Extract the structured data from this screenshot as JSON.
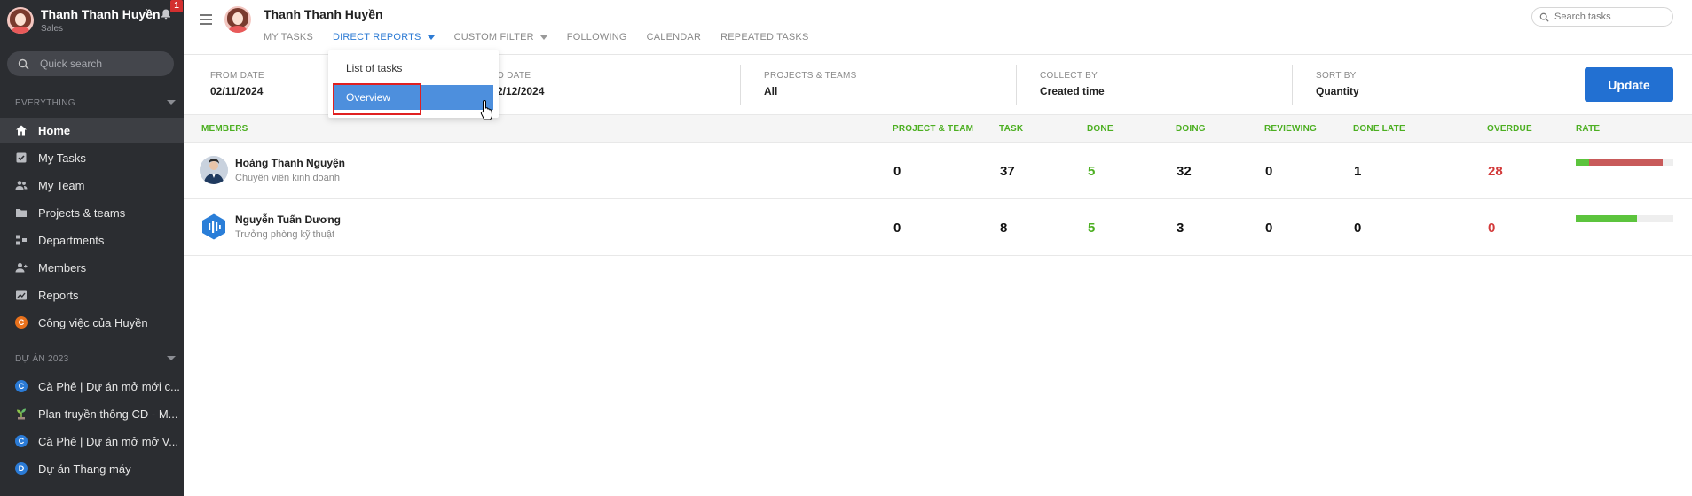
{
  "sidebar": {
    "user": {
      "name": "Thanh Thanh Huyền",
      "role": "Sales"
    },
    "notification_count": "1",
    "search_placeholder": "Quick search",
    "section_everything": "EVERYTHING",
    "items": [
      {
        "label": "Home",
        "icon": "home-icon",
        "active": true
      },
      {
        "label": "My Tasks",
        "icon": "checkbox-icon"
      },
      {
        "label": "My Team",
        "icon": "team-icon"
      },
      {
        "label": "Projects & teams",
        "icon": "folder-icon"
      },
      {
        "label": "Departments",
        "icon": "departments-icon"
      },
      {
        "label": "Members",
        "icon": "members-icon"
      },
      {
        "label": "Reports",
        "icon": "chart-icon"
      },
      {
        "label": "Công việc của Huyền",
        "icon": "letter-c-icon",
        "badge_letter": "C",
        "color": "#e8711c"
      }
    ],
    "section_projects": "DỰ ÁN 2023",
    "projects": [
      {
        "label": "Cà Phê | Dự án mở mới c...",
        "badge_letter": "C",
        "color": "#2b7bd6"
      },
      {
        "label": "Plan truyền thông CD - M...",
        "icon": "plant-icon"
      },
      {
        "label": "Cà Phê | Dự án mở mở V...",
        "badge_letter": "C",
        "color": "#2b7bd6"
      },
      {
        "label": "Dự án Thang máy",
        "badge_letter": "D",
        "color": "#2b7bd6"
      }
    ]
  },
  "header": {
    "title": "Thanh Thanh Huyền",
    "tabs": [
      {
        "label": "MY TASKS"
      },
      {
        "label": "DIRECT REPORTS",
        "active": true,
        "dropdown": true
      },
      {
        "label": "CUSTOM FILTER",
        "dropdown": true
      },
      {
        "label": "FOLLOWING"
      },
      {
        "label": "CALENDAR"
      },
      {
        "label": "REPEATED TASKS"
      }
    ],
    "search_placeholder": "Search tasks"
  },
  "dropdown": {
    "items": [
      {
        "label": "List of tasks"
      },
      {
        "label": "Overview",
        "selected": true
      }
    ]
  },
  "filters": {
    "from_date": {
      "label": "FROM DATE",
      "value": "02/11/2024"
    },
    "to_date": {
      "label": "TO DATE",
      "value": "02/12/2024",
      "visible_label": "O DATE",
      "visible_value": "2/12/2024"
    },
    "projects_teams": {
      "label": "PROJECTS & TEAMS",
      "value": "All"
    },
    "collect_by": {
      "label": "COLLECT BY",
      "value": "Created time"
    },
    "sort_by": {
      "label": "SORT BY",
      "value": "Quantity"
    },
    "update_label": "Update"
  },
  "table": {
    "columns": [
      "MEMBERS",
      "PROJECT & TEAM",
      "TASK",
      "DONE",
      "DOING",
      "REVIEWING",
      "DONE LATE",
      "OVERDUE",
      "RATE"
    ],
    "rows": [
      {
        "name": "Hoàng Thanh Nguyện",
        "role": "Chuyên viên kinh doanh",
        "project_team": "0",
        "task": "37",
        "done": "5",
        "doing": "32",
        "reviewing": "0",
        "done_late": "1",
        "overdue": "28",
        "rate": {
          "done_fraction": 0.135,
          "overdue_fraction": 0.757
        }
      },
      {
        "name": "Nguyễn Tuấn Dương",
        "role": "Trưởng phòng kỹ thuật",
        "project_team": "0",
        "task": "8",
        "done": "5",
        "doing": "3",
        "reviewing": "0",
        "done_late": "0",
        "overdue": "0",
        "rate": {
          "done_fraction": 0.625,
          "overdue_fraction": 0
        }
      }
    ]
  },
  "colors": {
    "sidebar_bg": "#2b2d31",
    "accent_blue": "#2270d2",
    "header_green": "#4caf21",
    "overdue_red": "#d33a3a",
    "rate_green": "#5cc43d",
    "rate_red": "#c85a5a"
  }
}
